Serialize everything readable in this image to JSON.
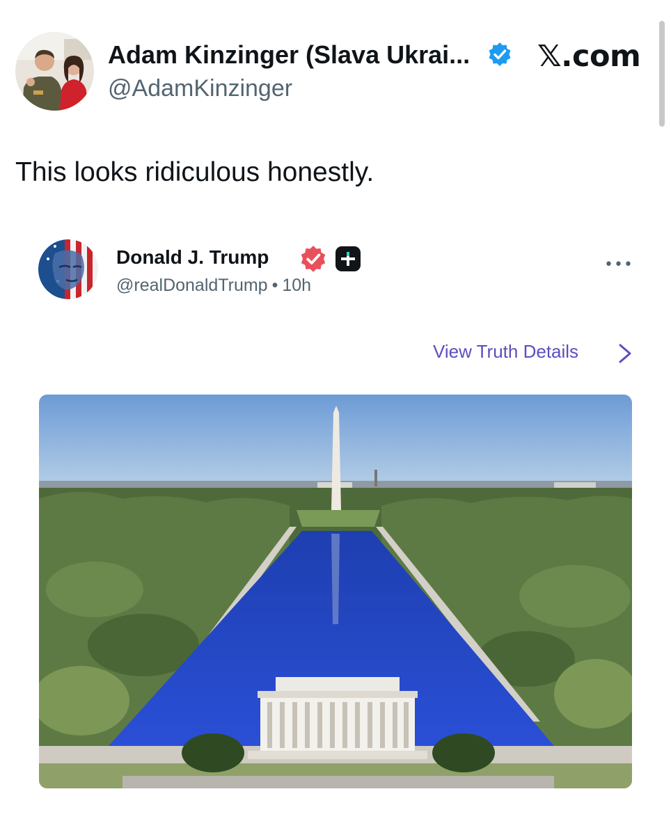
{
  "tweet": {
    "author_name": "Adam Kinzinger (Slava Ukrai...",
    "author_handle": "@AdamKinzinger",
    "source_label": "𝕏.com",
    "text": "This looks ridiculous honestly.",
    "verified_color": "#1d9bf0"
  },
  "embedded_post": {
    "author_name": "Donald J. Trump",
    "author_handle": "@realDonaldTrump",
    "separator": "•",
    "time_ago": "10h",
    "more_label": "•••",
    "view_details_label": "View Truth Details",
    "badge_color": "#e8505b",
    "link_color": "#5a4fbf",
    "image_alt": "Lincoln Memorial and Reflecting Pool with Washington Monument, pool water colored deep blue"
  }
}
